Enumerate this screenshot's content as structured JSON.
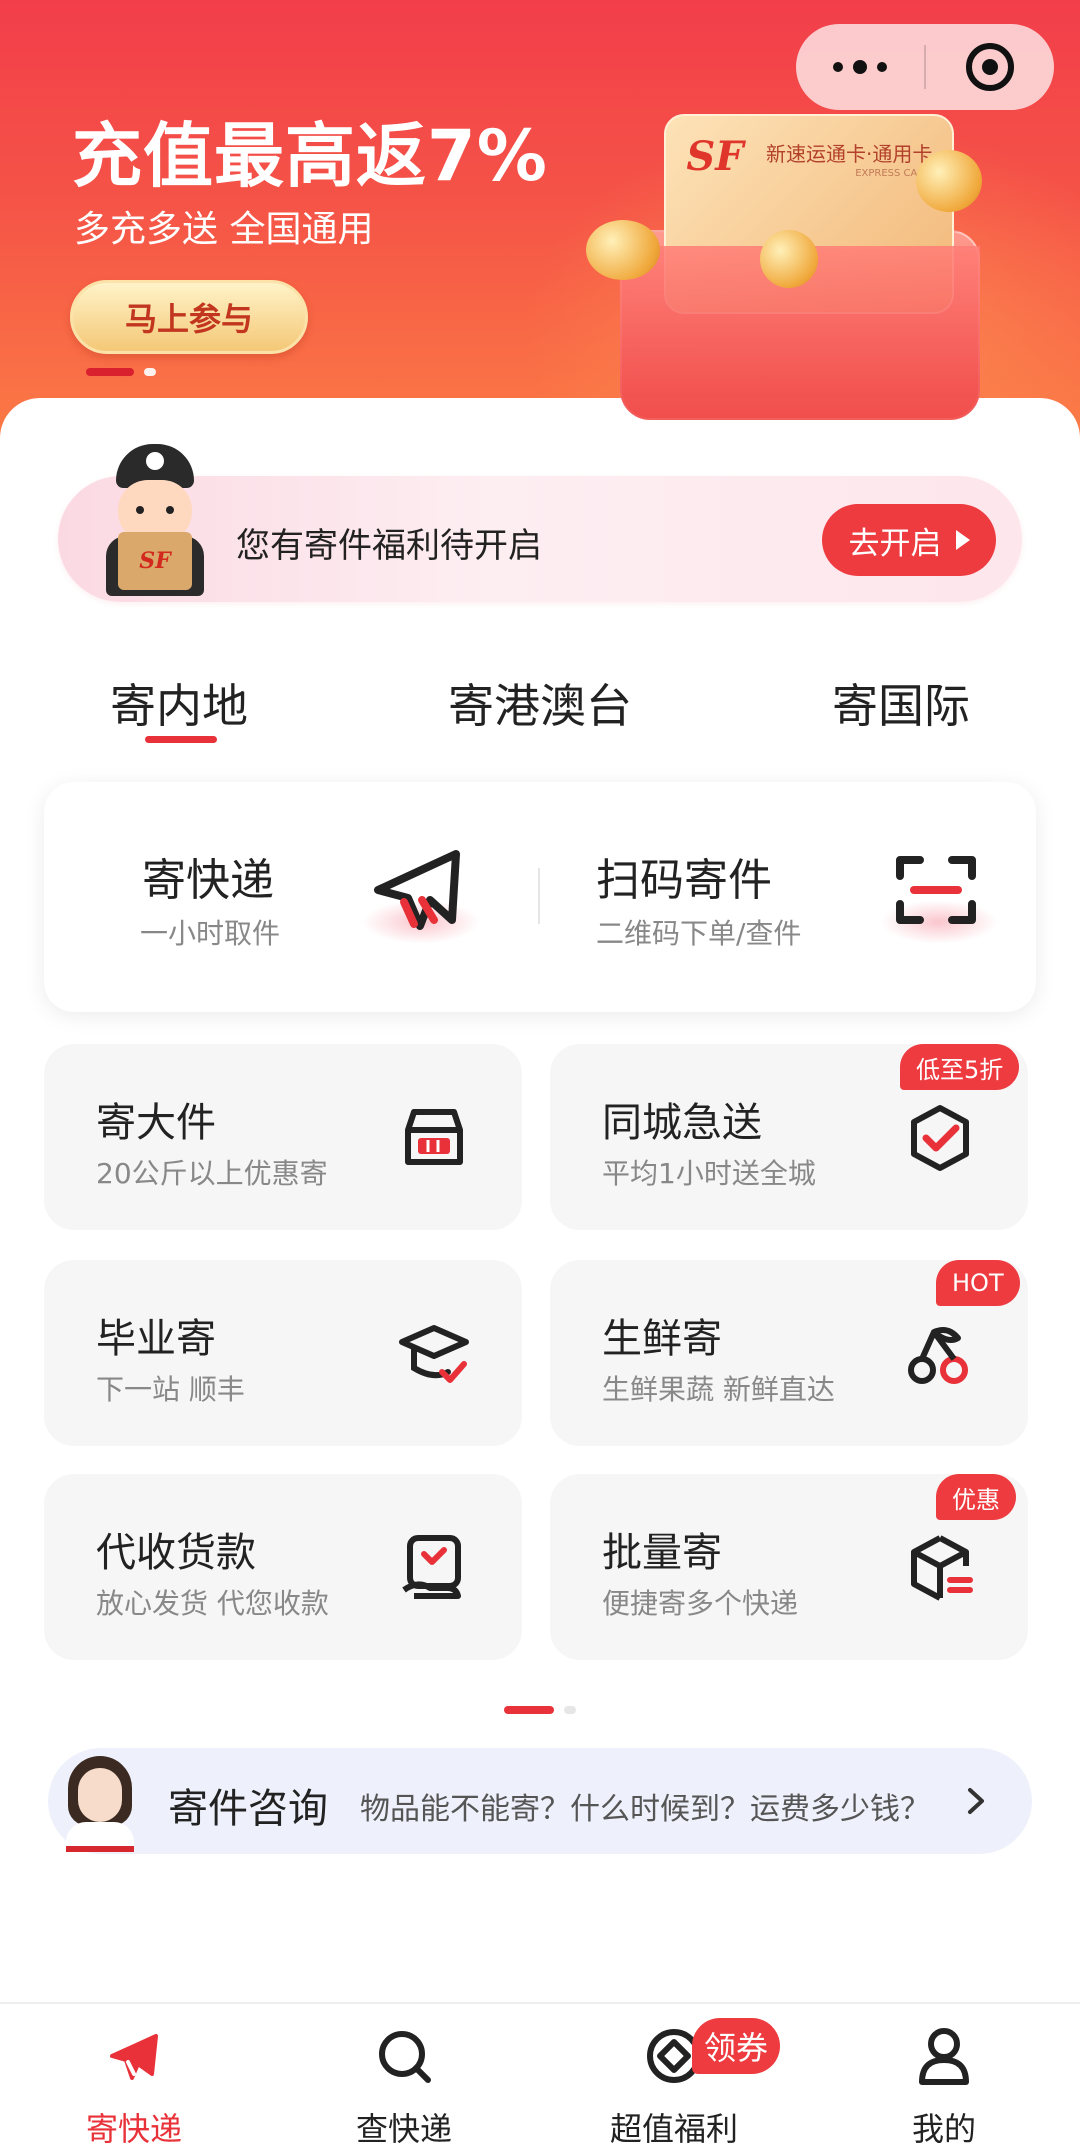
{
  "banner": {
    "title": "充值最高返7%",
    "subtitle": "多充多送 全国通用",
    "cta": "马上参与",
    "card_name": "新速运通卡·通用卡",
    "card_en": "EXPRESS CARD",
    "logo_text": "SF"
  },
  "capsule": {
    "more_icon": "more-dots-icon",
    "close_icon": "target-icon"
  },
  "welfare": {
    "text": "您有寄件福利待开启",
    "button": "去开启"
  },
  "tabs": [
    {
      "label": "寄内地",
      "active": true
    },
    {
      "label": "寄港澳台",
      "active": false
    },
    {
      "label": "寄国际",
      "active": false
    }
  ],
  "primary_services": [
    {
      "title": "寄快递",
      "subtitle": "一小时取件",
      "icon": "paper-plane-icon"
    },
    {
      "title": "扫码寄件",
      "subtitle": "二维码下单/查件",
      "icon": "scan-icon"
    }
  ],
  "services": [
    {
      "title": "寄大件",
      "subtitle": "20公斤以上优惠寄",
      "icon": "cargo-box-icon",
      "badge": ""
    },
    {
      "title": "同城急送",
      "subtitle": "平均1小时送全城",
      "icon": "shield-check-icon",
      "badge": "低至5折"
    },
    {
      "title": "毕业寄",
      "subtitle": "下一站 顺丰",
      "icon": "graduation-cap-icon",
      "badge": ""
    },
    {
      "title": "生鲜寄",
      "subtitle": "生鲜果蔬 新鲜直达",
      "icon": "cherry-icon",
      "badge": "HOT"
    },
    {
      "title": "代收货款",
      "subtitle": "放心发货 代您收款",
      "icon": "payment-collect-icon",
      "badge": ""
    },
    {
      "title": "批量寄",
      "subtitle": "便捷寄多个快递",
      "icon": "batch-box-icon",
      "badge": "优惠"
    }
  ],
  "consult": {
    "title": "寄件咨询",
    "question": "物品能不能寄？什么时候到？运费多少钱？"
  },
  "tabbar": [
    {
      "label": "寄快递",
      "icon": "send-plane-icon",
      "active": true
    },
    {
      "label": "查快递",
      "icon": "search-icon",
      "active": false
    },
    {
      "label": "超值福利",
      "icon": "benefit-icon",
      "active": false,
      "badge": "领券"
    },
    {
      "label": "我的",
      "icon": "user-icon",
      "active": false
    }
  ],
  "colors": {
    "accent": "#e83139",
    "banner_top": "#f23e4a",
    "banner_bottom": "#fb7a45"
  }
}
